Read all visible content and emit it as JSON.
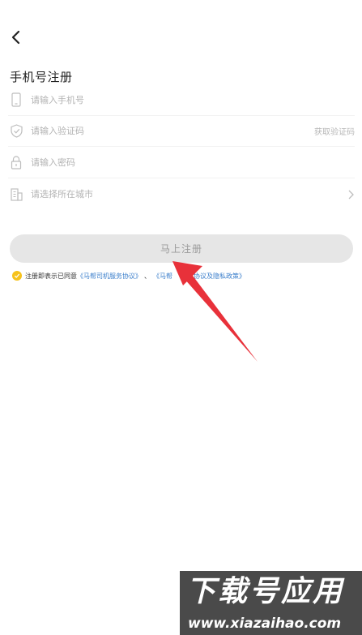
{
  "header": {
    "back_icon": "chevron-left-icon",
    "title": "手机号注册"
  },
  "form": {
    "phone": {
      "placeholder": "请输入手机号",
      "icon": "phone-icon"
    },
    "code": {
      "placeholder": "请输入验证码",
      "icon": "shield-check-icon",
      "action_label": "获取验证码"
    },
    "password": {
      "placeholder": "请输入密码",
      "icon": "lock-icon"
    },
    "city": {
      "placeholder": "请选择所在城市",
      "icon": "building-icon",
      "chevron": "chevron-right-icon"
    }
  },
  "submit_label": "马上注册",
  "agreement": {
    "prefix": "注册即表示已同意",
    "link1": "《马帮司机服务协议》",
    "separator": "、",
    "link2": "《马帮",
    "link2_rest": "用户协议及隐私政策》",
    "checked": true
  },
  "watermark": {
    "text": "下载号应用",
    "url": "www.xiazaihao.com"
  },
  "colors": {
    "accent": "#f6c21c",
    "link": "#3a7ecb",
    "arrow": "#e8313a",
    "button_bg": "#e6e6e6"
  }
}
